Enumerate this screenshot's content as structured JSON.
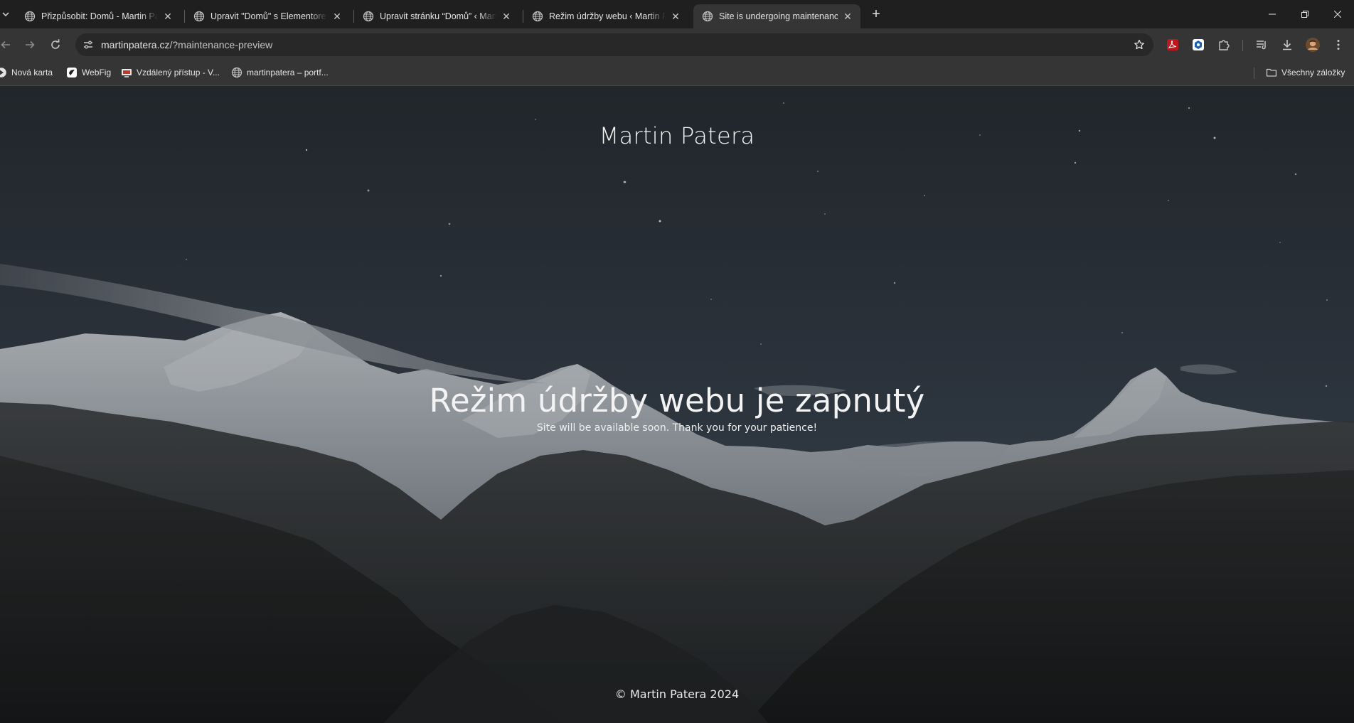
{
  "tabs": [
    {
      "title": "Přizpůsobit: Domů - Martin Patera",
      "active": false,
      "icon": "globe-icon"
    },
    {
      "title": "Upravit \"Domů\" s Elementorem",
      "active": false,
      "icon": "globe-icon"
    },
    {
      "title": "Upravit stránku “Domů” ‹ Martin Patera",
      "active": false,
      "icon": "globe-icon"
    },
    {
      "title": "Režim údržby webu ‹ Martin Patera",
      "active": false,
      "icon": "globe-icon"
    },
    {
      "title": "Site is undergoing maintenance",
      "active": true,
      "icon": "globe-icon"
    }
  ],
  "address_bar": {
    "domain": "martinpatera.cz",
    "path": "/?maintenance-preview"
  },
  "bookmarks": {
    "items": [
      {
        "label": "Nová karta",
        "icon": "new-tab-icon"
      },
      {
        "label": "WebFig",
        "icon": "webfig-icon"
      },
      {
        "label": "Vzdálený přístup - V...",
        "icon": "remote-access-icon"
      },
      {
        "label": "martinpatera – portf...",
        "icon": "globe-icon"
      }
    ],
    "all_bookmarks": "Všechny záložky"
  },
  "page": {
    "site_title": "Martin Patera",
    "headline": "Režim údržby webu je zapnutý",
    "subline": "Site will be available soon. Thank you for your patience!",
    "footer": "© Martin Patera 2024"
  },
  "colors": {
    "tab_strip": "#1f1f1f",
    "toolbar": "#353535",
    "omnibox": "#282828",
    "text": "#e3e3e3",
    "sky_top": "#262a30",
    "sky_bottom": "#3a4653"
  }
}
